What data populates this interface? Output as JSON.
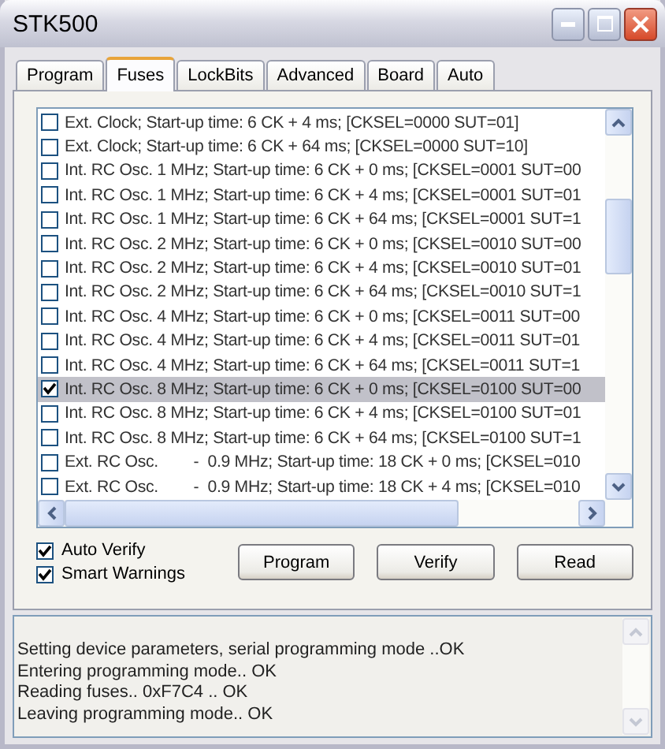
{
  "window": {
    "title": "STK500"
  },
  "tabs": [
    {
      "label": "Program",
      "selected": false
    },
    {
      "label": "Fuses",
      "selected": true
    },
    {
      "label": "LockBits",
      "selected": false
    },
    {
      "label": "Advanced",
      "selected": false
    },
    {
      "label": "Board",
      "selected": false
    },
    {
      "label": "Auto",
      "selected": false
    }
  ],
  "fuse_list": [
    {
      "label": "Ext. Clock; Start-up time: 6 CK + 4 ms; [CKSEL=0000 SUT=01]",
      "checked": false,
      "selected": false
    },
    {
      "label": "Ext. Clock; Start-up time: 6 CK + 64 ms; [CKSEL=0000 SUT=10]",
      "checked": false,
      "selected": false
    },
    {
      "label": "Int. RC Osc. 1 MHz; Start-up time: 6 CK + 0 ms; [CKSEL=0001 SUT=00",
      "checked": false,
      "selected": false
    },
    {
      "label": "Int. RC Osc. 1 MHz; Start-up time: 6 CK + 4 ms; [CKSEL=0001 SUT=01",
      "checked": false,
      "selected": false
    },
    {
      "label": "Int. RC Osc. 1 MHz; Start-up time: 6 CK + 64 ms; [CKSEL=0001 SUT=1",
      "checked": false,
      "selected": false
    },
    {
      "label": "Int. RC Osc. 2 MHz; Start-up time: 6 CK + 0 ms; [CKSEL=0010 SUT=00",
      "checked": false,
      "selected": false
    },
    {
      "label": "Int. RC Osc. 2 MHz; Start-up time: 6 CK + 4 ms; [CKSEL=0010 SUT=01",
      "checked": false,
      "selected": false
    },
    {
      "label": "Int. RC Osc. 2 MHz; Start-up time: 6 CK + 64 ms; [CKSEL=0010 SUT=1",
      "checked": false,
      "selected": false
    },
    {
      "label": "Int. RC Osc. 4 MHz; Start-up time: 6 CK + 0 ms; [CKSEL=0011 SUT=00",
      "checked": false,
      "selected": false
    },
    {
      "label": "Int. RC Osc. 4 MHz; Start-up time: 6 CK + 4 ms; [CKSEL=0011 SUT=01",
      "checked": false,
      "selected": false
    },
    {
      "label": "Int. RC Osc. 4 MHz; Start-up time: 6 CK + 64 ms; [CKSEL=0011 SUT=1",
      "checked": false,
      "selected": false
    },
    {
      "label": "Int. RC Osc. 8 MHz; Start-up time: 6 CK + 0 ms; [CKSEL=0100 SUT=00",
      "checked": true,
      "selected": true
    },
    {
      "label": "Int. RC Osc. 8 MHz; Start-up time: 6 CK + 4 ms; [CKSEL=0100 SUT=01",
      "checked": false,
      "selected": false
    },
    {
      "label": "Int. RC Osc. 8 MHz; Start-up time: 6 CK + 64 ms; [CKSEL=0100 SUT=1",
      "checked": false,
      "selected": false
    },
    {
      "label": "Ext. RC Osc.        -  0.9 MHz; Start-up time: 18 CK + 0 ms; [CKSEL=010",
      "checked": false,
      "selected": false
    },
    {
      "label": "Ext. RC Osc.        -  0.9 MHz; Start-up time: 18 CK + 4 ms; [CKSEL=010",
      "checked": false,
      "selected": false
    }
  ],
  "options": [
    {
      "label": "Auto Verify",
      "checked": true
    },
    {
      "label": "Smart Warnings",
      "checked": true
    }
  ],
  "buttons": [
    "Program",
    "Verify",
    "Read"
  ],
  "log": [
    "Setting device parameters, serial programming mode ..OK",
    "Entering programming mode.. OK",
    "Reading fuses.. 0xF7C4 .. OK",
    "Leaving programming mode.. OK"
  ]
}
